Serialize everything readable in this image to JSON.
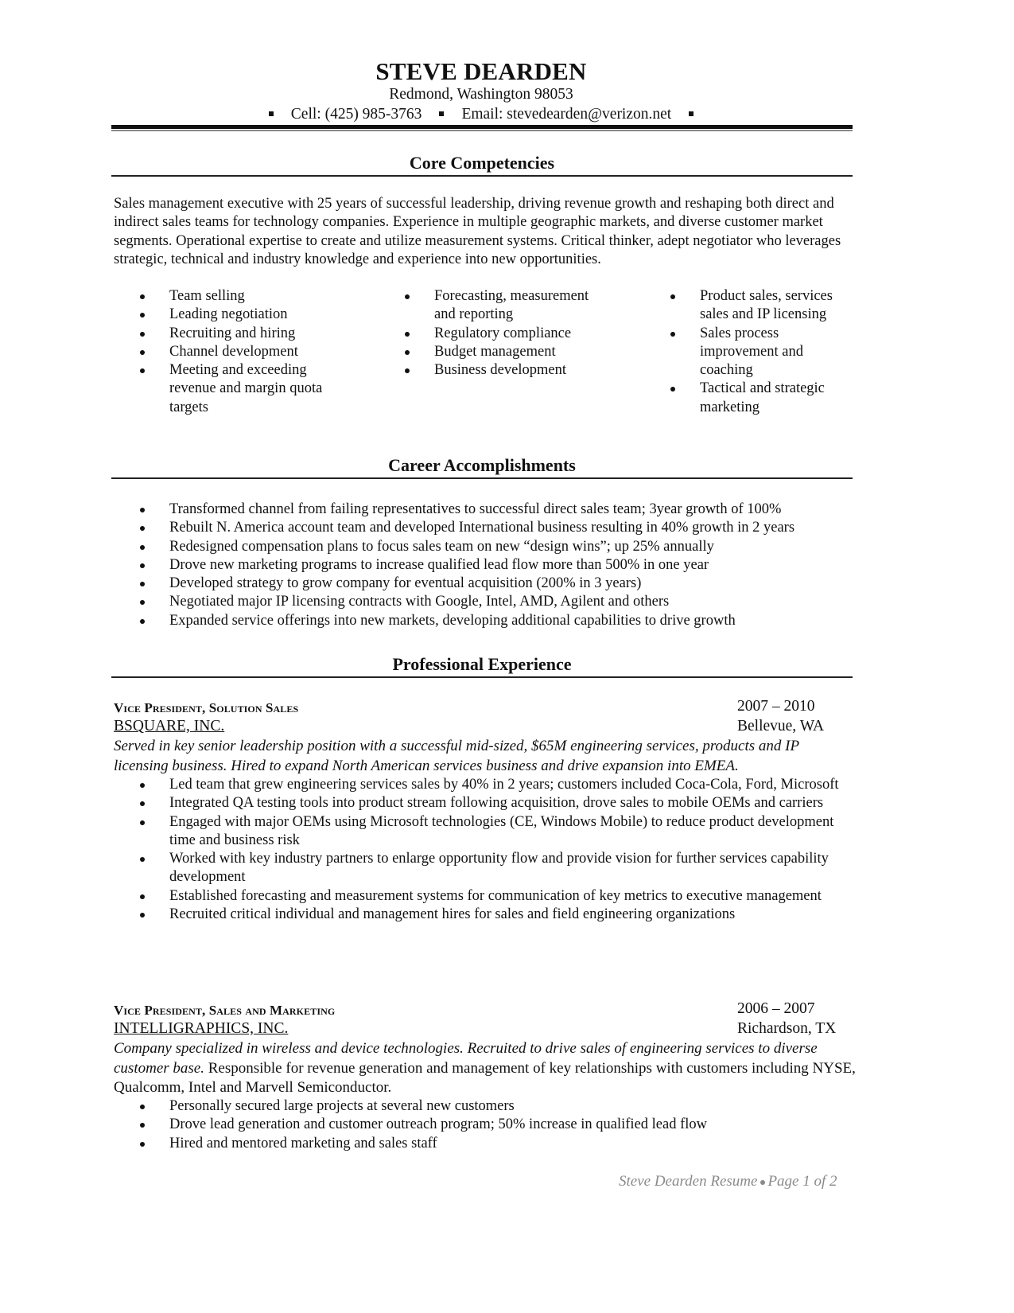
{
  "header": {
    "name": "STEVE DEARDEN",
    "address": "Redmond, Washington 98053",
    "cell": "Cell: (425) 985-3763",
    "email": "Email: stevedearden@verizon.net"
  },
  "core_competencies": {
    "title": "Core Competencies",
    "summary": "Sales management executive with 25 years of successful leadership, driving revenue growth and reshaping both direct and indirect sales teams for technology companies. Experience in multiple geographic markets, and diverse customer market segments. Operational expertise to create and utilize measurement systems.  Critical thinker, adept negotiator who leverages strategic, technical and industry knowledge and experience into new opportunities.",
    "columns": [
      [
        "Team selling",
        "Leading negotiation",
        "Recruiting and hiring",
        "Channel development",
        "Meeting and exceeding revenue and margin quota targets"
      ],
      [
        "Forecasting, measurement and reporting",
        "Regulatory compliance",
        "Budget management",
        "Business development"
      ],
      [
        "Product sales, services sales  and IP licensing",
        "Sales process improvement and coaching",
        "Tactical and strategic marketing"
      ]
    ]
  },
  "career_accomplishments": {
    "title": "Career Accomplishments",
    "items": [
      "Transformed channel from failing representatives to successful direct sales team; 3year growth of 100%",
      "Rebuilt N. America account team and developed International business resulting in 40% growth in 2 years",
      "Redesigned compensation plans to focus sales team on new “design wins”; up 25% annually",
      "Drove new marketing programs to increase qualified lead flow more than 500% in one year",
      "Developed strategy to grow company for eventual acquisition (200% in 3 years)",
      "Negotiated major IP licensing contracts with Google, Intel, AMD, Agilent and others",
      "Expanded service offerings into new markets, developing additional capabilities to drive growth"
    ]
  },
  "professional_experience": {
    "title": "Professional Experience",
    "jobs": [
      {
        "title": "Vice President, Solution Sales",
        "dates": "2007 – 2010",
        "company": "BSQUARE, INC.",
        "location": "Bellevue, WA",
        "description_italic": "Served in key senior leadership position with a successful mid-sized, $65M engineering services, products and IP licensing business.  Hired to expand North American services business and drive expansion into EMEA.",
        "description_plain": "",
        "bullets": [
          "Led team that grew engineering services sales by 40% in 2 years; customers included Coca-Cola, Ford, Microsoft",
          "Integrated QA testing tools into product stream following acquisition, drove sales to mobile OEMs and carriers",
          "Engaged with major OEMs using Microsoft technologies (CE, Windows Mobile) to reduce product development time and business risk",
          "Worked with key industry partners to enlarge opportunity flow and provide vision for further services capability development",
          "Established forecasting and measurement systems for communication of key metrics to executive management",
          "Recruited critical individual and management hires for sales and field engineering organizations"
        ]
      },
      {
        "title": "Vice President, Sales and Marketing",
        "dates": "2006 – 2007",
        "company": "INTELLIGRAPHICS, INC.",
        "location": "Richardson, TX",
        "description_italic": "Company specialized in wireless and device technologies. Recruited to drive sales of engineering services to diverse customer base.",
        "description_plain": " Responsible for revenue generation and management of key relationships with customers including NYSE, Qualcomm, Intel and Marvell Semiconductor.",
        "bullets": [
          "Personally secured large projects at several new customers",
          "Drove lead generation and customer outreach program; 50% increase in qualified lead flow",
          "Hired and mentored marketing and sales staff"
        ]
      }
    ]
  },
  "footer": {
    "left": "Steve Dearden Resume",
    "right": "Page 1 of 2"
  }
}
